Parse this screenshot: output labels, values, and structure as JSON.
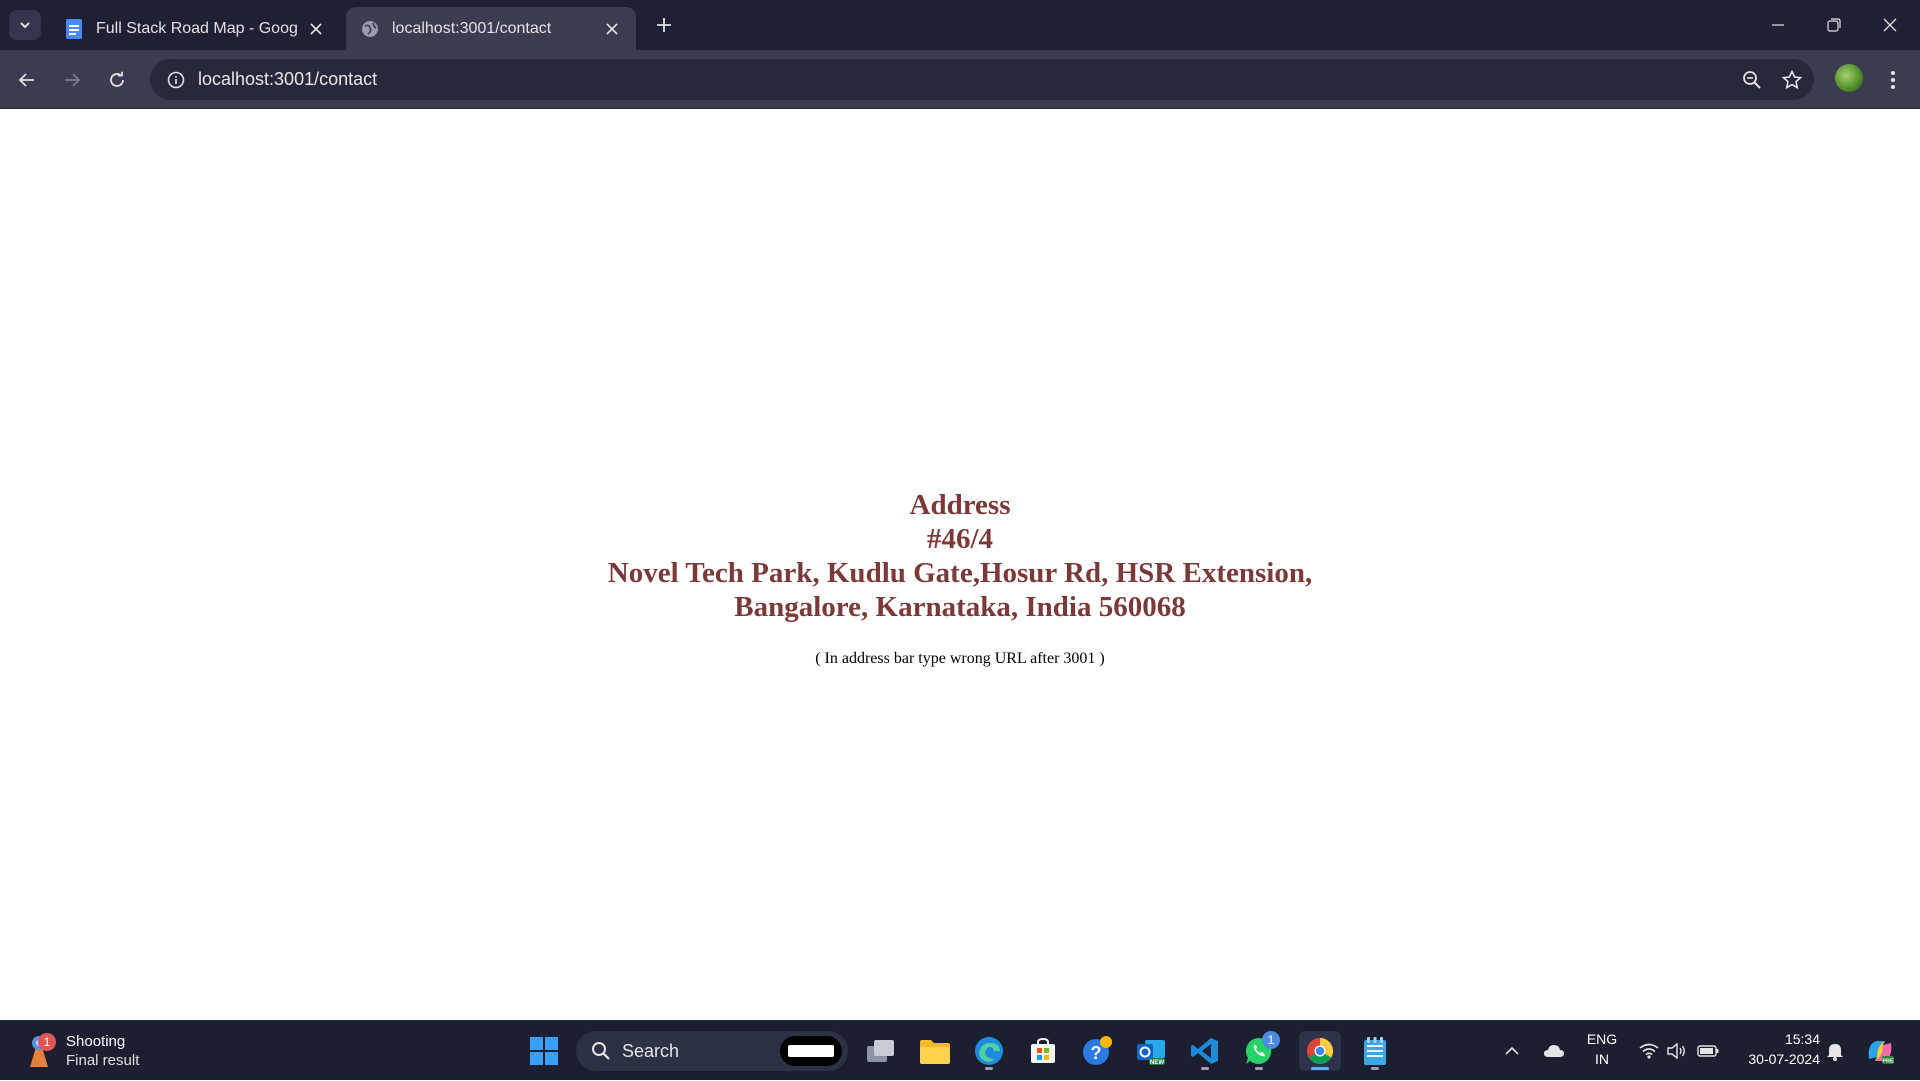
{
  "browser": {
    "tabs": [
      {
        "title": "Full Stack Road Map - Google D",
        "favicon": "google-docs-icon",
        "active": false
      },
      {
        "title": "localhost:3001/contact",
        "favicon": "globe-icon",
        "active": true
      }
    ],
    "url": "localhost:3001/contact",
    "colors": {
      "tabstrip": "#1f1f36",
      "toolbar": "#3b3b52",
      "omnibox": "#28283c"
    }
  },
  "page": {
    "heading": "Address",
    "line1": "#46/4",
    "line2": "Novel Tech Park, Kudlu Gate,Hosur Rd, HSR Extension,",
    "line3": "Bangalore, Karnataka, India 560068",
    "hint": "( In address bar type wrong URL after 3001 )",
    "colors": {
      "address_text": "#7b3a3a",
      "hint_text": "#000000",
      "background": "#ffffff"
    }
  },
  "taskbar": {
    "widget": {
      "badge": "1",
      "title": "Shooting",
      "subtitle": "Final result"
    },
    "search_label": "Search",
    "apps": [
      {
        "name": "start-icon"
      },
      {
        "name": "task-view-icon"
      },
      {
        "name": "file-explorer-icon"
      },
      {
        "name": "edge-icon"
      },
      {
        "name": "microsoft-store-icon"
      },
      {
        "name": "get-help-icon"
      },
      {
        "name": "outlook-icon"
      },
      {
        "name": "vscode-icon"
      },
      {
        "name": "whatsapp-icon",
        "badge": "1"
      },
      {
        "name": "chrome-icon"
      },
      {
        "name": "notepad-icon"
      }
    ],
    "tray": {
      "lang_line1": "ENG",
      "lang_line2": "IN",
      "time": "15:34",
      "date": "30-07-2024"
    }
  }
}
